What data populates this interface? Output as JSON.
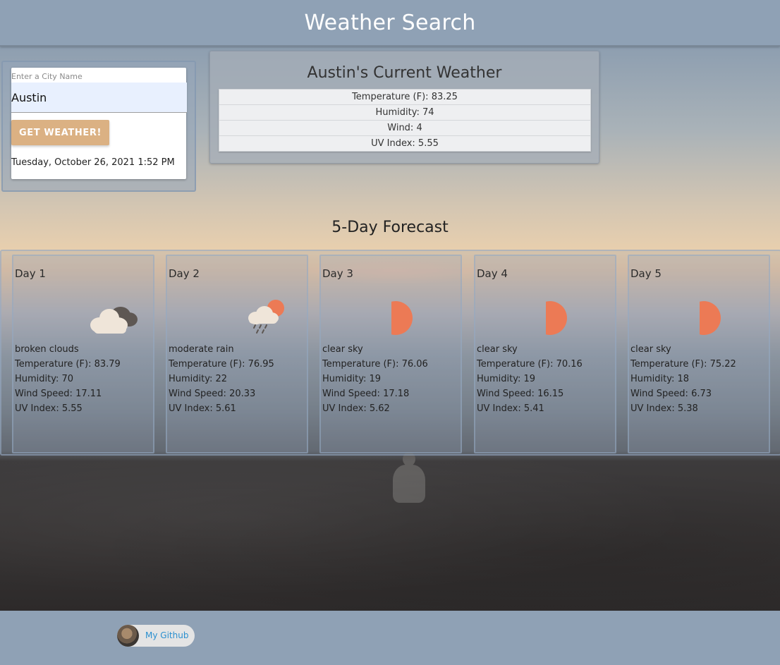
{
  "header": {
    "title": "Weather Search"
  },
  "search": {
    "label": "Enter a City Name",
    "value": "Austin",
    "button_label": "GET WEATHER!",
    "datetime": "Tuesday, October 26, 2021 1:52 PM"
  },
  "current": {
    "title": "Austin's Current Weather",
    "rows": [
      "Temperature (F): 83.25",
      "Humidity: 74",
      "Wind: 4",
      "UV Index: 5.55"
    ]
  },
  "forecast": {
    "title": "5-Day Forecast",
    "days": [
      {
        "title": "Day 1",
        "icon": "broken-clouds-icon",
        "desc": "broken clouds",
        "temp": "Temperature (F): 83.79",
        "humidity": "Humidity: 70",
        "wind": "Wind Speed: 17.11",
        "uv": "UV Index: 5.55"
      },
      {
        "title": "Day 2",
        "icon": "moderate-rain-icon",
        "desc": "moderate rain",
        "temp": "Temperature (F): 76.95",
        "humidity": "Humidity: 22",
        "wind": "Wind Speed: 20.33",
        "uv": "UV Index: 5.61"
      },
      {
        "title": "Day 3",
        "icon": "clear-sky-icon",
        "desc": "clear sky",
        "temp": "Temperature (F): 76.06",
        "humidity": "Humidity: 19",
        "wind": "Wind Speed: 17.18",
        "uv": "UV Index: 5.62"
      },
      {
        "title": "Day 4",
        "icon": "clear-sky-icon",
        "desc": "clear sky",
        "temp": "Temperature (F): 70.16",
        "humidity": "Humidity: 19",
        "wind": "Wind Speed: 16.15",
        "uv": "UV Index: 5.41"
      },
      {
        "title": "Day 5",
        "icon": "clear-sky-icon",
        "desc": "clear sky",
        "temp": "Temperature (F): 75.22",
        "humidity": "Humidity: 18",
        "wind": "Wind Speed: 6.73",
        "uv": "UV Index: 5.38"
      }
    ]
  },
  "footer": {
    "github_label": "My Github"
  },
  "colors": {
    "button": "#dbb183",
    "header": "#8fa1b5",
    "sun": "#ec7a55",
    "link": "#2a8fcf"
  }
}
